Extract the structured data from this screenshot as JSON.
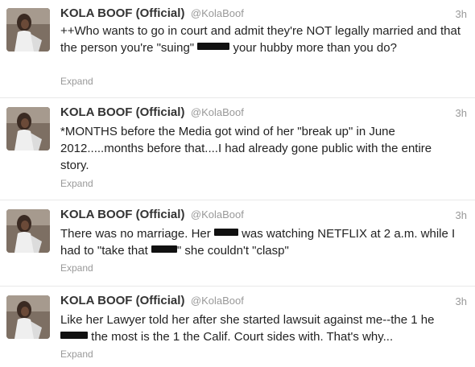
{
  "tweets": [
    {
      "fullname": "KOLA BOOF (Official)",
      "username": "@KolaBoof",
      "time": "3h",
      "text_parts": [
        "++Who wants to go in court and admit they're NOT legally married and that the person you're \"suing\" ",
        " your hubby more than you do?"
      ],
      "expand": "Expand"
    },
    {
      "fullname": "KOLA BOOF (Official)",
      "username": "@KolaBoof",
      "time": "3h",
      "text": "*MONTHS before the Media got wind of her \"break up\" in June 2012.....months before that....I had already gone public with the entire story.",
      "expand": "Expand"
    },
    {
      "fullname": "KOLA BOOF (Official)",
      "username": "@KolaBoof",
      "time": "3h",
      "text_parts": [
        "There was no marriage. Her ",
        " was watching NETFLIX at 2 a.m. while I had to \"take that ",
        "\" she couldn't \"clasp\""
      ],
      "expand": "Expand"
    },
    {
      "fullname": "KOLA BOOF (Official)",
      "username": "@KolaBoof",
      "time": "3h",
      "text_parts": [
        "Like her Lawyer told her after she started lawsuit against me--the 1 he ",
        " the most is the 1 the Calif. Court sides with. That's why..."
      ],
      "expand": "Expand"
    }
  ],
  "colors": {
    "name": "#333333",
    "meta": "#999999",
    "divider": "#e8e8e8",
    "redaction": "#111111"
  },
  "icons": {
    "avatar": "profile-photo-avatar"
  }
}
